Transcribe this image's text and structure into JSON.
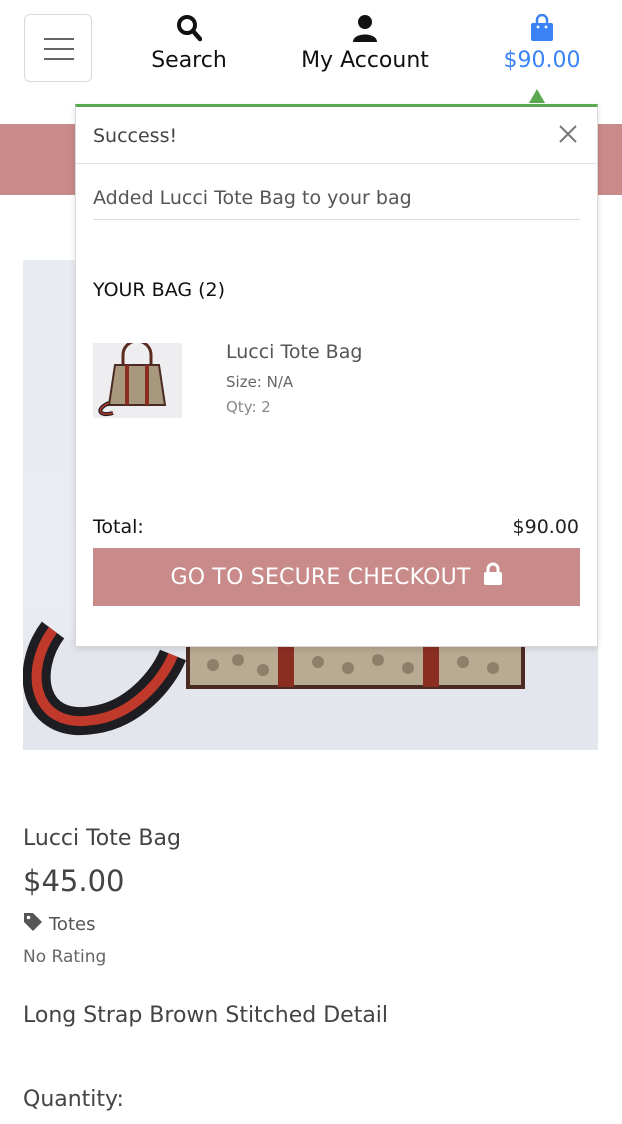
{
  "nav": {
    "menu_icon": "hamburger-icon",
    "search": {
      "label": "Search",
      "icon": "search-icon"
    },
    "account": {
      "label": "My Account",
      "icon": "user-icon"
    },
    "bag": {
      "label": "$90.00",
      "icon": "shopping-bag-icon",
      "color": "#3b82f6"
    }
  },
  "toast": {
    "title": "Success!",
    "message": "Added Lucci Tote Bag to your bag",
    "accent_color": "#5aa84f",
    "bag_heading": "YOUR BAG (2)",
    "item": {
      "name": "Lucci Tote Bag",
      "size": "Size: N/A",
      "qty": "Qty: 2"
    },
    "total_label": "Total:",
    "total_value": "$90.00",
    "checkout_label": "GO TO SECURE CHECKOUT",
    "checkout_icon": "lock-icon",
    "checkout_color": "#c98a8a"
  },
  "product": {
    "name": "Lucci Tote Bag",
    "price": "$45.00",
    "category": "Totes",
    "category_icon": "tag-icon",
    "rating": "No Rating",
    "description": "Long Strap Brown Stitched Detail",
    "quantity_label": "Quantity:"
  }
}
